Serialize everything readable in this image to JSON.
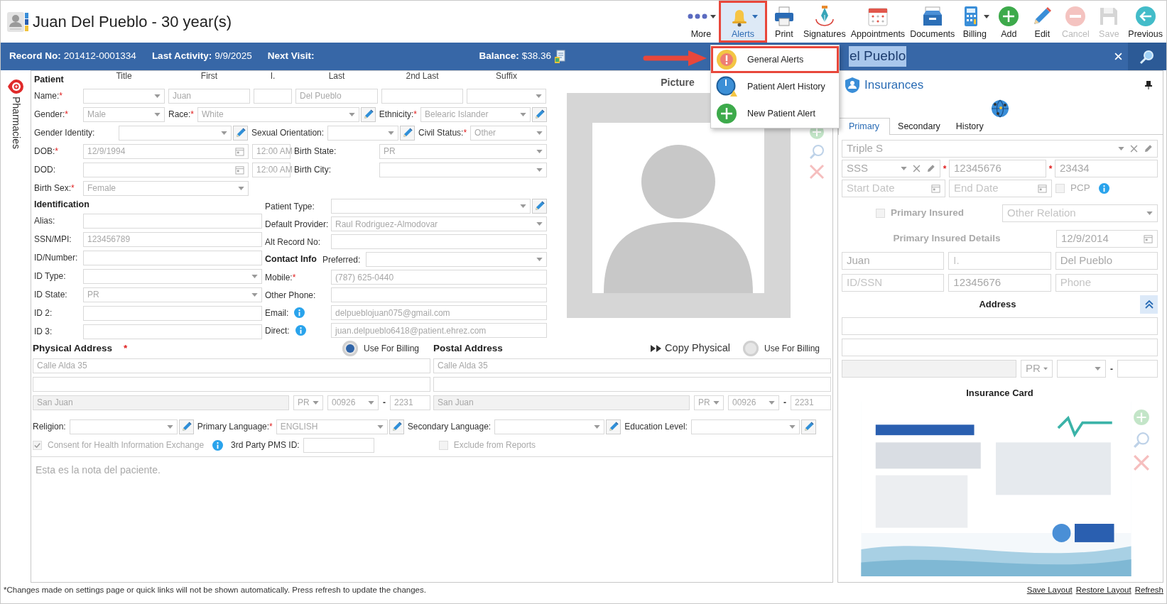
{
  "header": {
    "title": "Juan Del Pueblo - 30 year(s)"
  },
  "toolbar": [
    {
      "label": "More",
      "dropdown": true,
      "disabled": false,
      "selected": false
    },
    {
      "label": "Alerts",
      "dropdown": true,
      "disabled": false,
      "selected": true
    },
    {
      "label": "Print",
      "dropdown": false,
      "disabled": false,
      "selected": false
    },
    {
      "label": "Signatures",
      "dropdown": false,
      "disabled": false,
      "selected": false
    },
    {
      "label": "Appointments",
      "dropdown": false,
      "disabled": false,
      "selected": false
    },
    {
      "label": "Documents",
      "dropdown": false,
      "disabled": false,
      "selected": false
    },
    {
      "label": "Billing",
      "dropdown": true,
      "disabled": false,
      "selected": false
    },
    {
      "label": "Add",
      "dropdown": false,
      "disabled": false,
      "selected": false
    },
    {
      "label": "Edit",
      "dropdown": false,
      "disabled": false,
      "selected": false
    },
    {
      "label": "Cancel",
      "dropdown": false,
      "disabled": true,
      "selected": false
    },
    {
      "label": "Save",
      "dropdown": false,
      "disabled": true,
      "selected": false
    },
    {
      "label": "Previous",
      "dropdown": false,
      "disabled": false,
      "selected": false
    }
  ],
  "info_bar": [
    {
      "label": "Record No:",
      "value": "201412-0001334"
    },
    {
      "label": "Last Activity:",
      "value": "9/9/2025"
    },
    {
      "label": "Next Visit:"
    },
    {
      "label": "Balance:",
      "value": "$38.36"
    }
  ],
  "search": {
    "value": "el Pueblo"
  },
  "alerts_menu": [
    {
      "label": "General Alerts",
      "selected": true
    },
    {
      "label": "Patient Alert History",
      "selected": false
    },
    {
      "label": "New Patient Alert",
      "selected": false
    }
  ],
  "side_tabs": [
    {
      "label": "Pharmacies"
    }
  ],
  "patient": {
    "heading": "Patient",
    "name_columns": [
      "Title",
      "First",
      "I.",
      "Last",
      "2nd Last",
      "Suffix"
    ],
    "rows": [
      {
        "items": [
          {
            "kind": "label",
            "text": "Name:",
            "required_mark": "*"
          },
          {
            "kind": "select"
          },
          {
            "kind": "text",
            "value": "Juan"
          },
          {
            "kind": "text"
          },
          {
            "kind": "text",
            "value": "Del Pueblo"
          },
          {
            "kind": "text"
          },
          {
            "kind": "select"
          }
        ]
      },
      {
        "items": [
          {
            "kind": "label",
            "text": "Gender:",
            "required_mark": "*"
          },
          {
            "kind": "select",
            "value": "Male"
          },
          {
            "kind": "label",
            "text": "Race:",
            "required_mark": "*"
          },
          {
            "kind": "select",
            "value": "White",
            "editable": true
          },
          {
            "kind": "label",
            "text": "Ethnicity:",
            "required_mark": "*"
          },
          {
            "kind": "select",
            "value": "Belearic Islander",
            "editable": true
          }
        ]
      },
      {
        "items": [
          {
            "kind": "label",
            "text": "Gender Identity:"
          },
          {
            "kind": "select",
            "editable": true
          },
          {
            "kind": "label",
            "text": "Sexual Orientation:"
          },
          {
            "kind": "select",
            "editable": true
          },
          {
            "kind": "label",
            "text": "Civil Status:",
            "required_mark": "*"
          },
          {
            "kind": "select",
            "value": "Other"
          }
        ]
      },
      {
        "items": [
          {
            "kind": "label",
            "text": "DOB:",
            "required_mark": "*"
          },
          {
            "kind": "date",
            "value": "12/9/1994"
          },
          {
            "kind": "time",
            "value": "12:00 AM"
          },
          {
            "kind": "label",
            "text": "Birth State:"
          },
          {
            "kind": "select",
            "value": "PR"
          }
        ]
      },
      {
        "items": [
          {
            "kind": "label",
            "text": "DOD:"
          },
          {
            "kind": "date"
          },
          {
            "kind": "time",
            "value": "12:00 AM"
          },
          {
            "kind": "label",
            "text": "Birth City:"
          },
          {
            "kind": "select"
          }
        ]
      },
      {
        "items": [
          {
            "kind": "label",
            "text": "Birth Sex:",
            "required_mark": "*"
          },
          {
            "kind": "select",
            "value": "Female"
          }
        ]
      }
    ]
  },
  "identification": {
    "heading": "Identification",
    "rows": [
      {
        "items": [
          {
            "kind": "label",
            "text": "Alias:"
          },
          {
            "kind": "text"
          }
        ]
      },
      {
        "items": [
          {
            "kind": "label",
            "text": "SSN/MPI:"
          },
          {
            "kind": "text",
            "value": "123456789"
          }
        ]
      },
      {
        "items": [
          {
            "kind": "label",
            "text": "ID/Number:"
          },
          {
            "kind": "text"
          }
        ]
      },
      {
        "items": [
          {
            "kind": "label",
            "text": "ID Type:"
          },
          {
            "kind": "select"
          }
        ]
      },
      {
        "items": [
          {
            "kind": "label",
            "text": "ID State:"
          },
          {
            "kind": "select",
            "value": "PR"
          }
        ]
      },
      {
        "items": [
          {
            "kind": "label",
            "text": "ID 2:"
          },
          {
            "kind": "text"
          }
        ]
      },
      {
        "items": [
          {
            "kind": "label",
            "text": "ID 3:"
          },
          {
            "kind": "text"
          }
        ]
      }
    ]
  },
  "contact": {
    "rows": [
      {
        "items": [
          {
            "kind": "label",
            "text": "Patient Type:"
          },
          {
            "kind": "select",
            "editable": true
          }
        ]
      },
      {
        "items": [
          {
            "kind": "label",
            "text": "Default Provider:"
          },
          {
            "kind": "select",
            "value": "Raul Rodriguez-Almodovar"
          }
        ]
      },
      {
        "items": [
          {
            "kind": "label",
            "text": "Alt Record No:"
          },
          {
            "kind": "text"
          }
        ]
      },
      {
        "items": [
          {
            "kind": "heading",
            "text": "Contact Info"
          },
          {
            "kind": "label",
            "text": "Preferred:"
          },
          {
            "kind": "select"
          }
        ]
      },
      {
        "items": [
          {
            "kind": "label",
            "text": "Mobile:",
            "required_mark": "*"
          },
          {
            "kind": "text",
            "value": "(787) 625-0440"
          }
        ]
      },
      {
        "items": [
          {
            "kind": "label",
            "text": "Other Phone:"
          },
          {
            "kind": "text"
          }
        ]
      },
      {
        "items": [
          {
            "kind": "label",
            "text": "Email:",
            "info": true
          },
          {
            "kind": "text",
            "value": "delpueblojuan075@gmail.com"
          }
        ]
      },
      {
        "items": [
          {
            "kind": "label",
            "text": "Direct:",
            "info": true
          },
          {
            "kind": "text",
            "value": "juan.delpueblo6418@patient.ehrez.com"
          }
        ]
      }
    ]
  },
  "picture": {
    "label": "Picture"
  },
  "addresses": [
    {
      "heading": "Physical Address",
      "required_mark": "*",
      "billing": {
        "label": "Use For Billing",
        "selected": true
      },
      "fields": [
        {
          "kind": "text",
          "value": "Calle Alda 35"
        },
        {
          "kind": "text"
        },
        {
          "kind": "text",
          "value": "San Juan",
          "disabled": true
        },
        {
          "kind": "select",
          "value": "PR"
        },
        {
          "kind": "select",
          "value": "00926"
        },
        {
          "kind": "separator",
          "text": "-"
        },
        {
          "kind": "text",
          "value": "2231"
        }
      ]
    },
    {
      "heading": "Postal Address",
      "copy_label": "Copy Physical",
      "billing": {
        "label": "Use For Billing",
        "selected": false
      },
      "fields": [
        {
          "kind": "text",
          "value": "Calle Alda 35"
        },
        {
          "kind": "text"
        },
        {
          "kind": "text",
          "value": "San Juan",
          "disabled": true
        },
        {
          "kind": "select",
          "value": "PR"
        },
        {
          "kind": "select",
          "value": "00926"
        },
        {
          "kind": "separator",
          "text": "-"
        },
        {
          "kind": "text",
          "value": "2231"
        }
      ]
    }
  ],
  "other_rows": [
    {
      "items": [
        {
          "kind": "label",
          "text": "Religion:"
        },
        {
          "kind": "select",
          "editable": true
        },
        {
          "kind": "label",
          "text": "Primary Language:",
          "required_mark": "*"
        },
        {
          "kind": "select",
          "value": "ENGLISH",
          "editable": true
        },
        {
          "kind": "label",
          "text": "Secondary Language:"
        },
        {
          "kind": "select",
          "editable": true
        },
        {
          "kind": "label",
          "text": "Education Level:"
        },
        {
          "kind": "select",
          "editable": true
        }
      ]
    },
    {
      "items": [
        {
          "kind": "checkbox",
          "label": "Consent for Health Information Exchange",
          "checked": true,
          "disabled": true,
          "info": true
        },
        {
          "kind": "label",
          "text": "3rd Party PMS ID:"
        },
        {
          "kind": "text"
        },
        {
          "kind": "checkbox",
          "label": "Exclude from Reports",
          "checked": false,
          "disabled": true
        }
      ]
    }
  ],
  "note": {
    "value": "Esta es la nota del paciente."
  },
  "insurances": {
    "title": "Insurances",
    "tabs": [
      {
        "label": "Primary",
        "selected": true
      },
      {
        "label": "Secondary",
        "selected": false
      },
      {
        "label": "History",
        "selected": false
      }
    ],
    "rows": [
      {
        "items": [
          {
            "kind": "select",
            "value": "Triple S",
            "clearable": true,
            "editable": true
          }
        ]
      },
      {
        "items": [
          {
            "kind": "select",
            "value": "SSS",
            "clearable": true,
            "editable": true
          },
          {
            "kind": "required_mark",
            "text": "*"
          },
          {
            "kind": "text",
            "value": "12345676"
          },
          {
            "kind": "required_mark",
            "text": "*"
          },
          {
            "kind": "text",
            "value": "23434"
          }
        ]
      },
      {
        "items": [
          {
            "kind": "date",
            "placeholder": "Start Date"
          },
          {
            "kind": "date",
            "placeholder": "End Date"
          },
          {
            "kind": "checkbox",
            "label": "PCP",
            "checked": false,
            "disabled": true,
            "info": true
          }
        ]
      },
      {
        "items": [
          {
            "kind": "checkbox",
            "label": "Primary Insured",
            "checked": false,
            "disabled": true
          },
          {
            "kind": "select",
            "placeholder": "Other Relation"
          }
        ]
      },
      {
        "items": [
          {
            "kind": "heading",
            "text": "Primary Insured Details",
            "disabled": true
          },
          {
            "kind": "date",
            "value": "12/9/2014"
          }
        ]
      },
      {
        "items": [
          {
            "kind": "text",
            "value": "Juan"
          },
          {
            "kind": "text",
            "placeholder": "I."
          },
          {
            "kind": "text",
            "value": "Del Pueblo"
          }
        ]
      },
      {
        "items": [
          {
            "kind": "text",
            "placeholder": "ID/SSN"
          },
          {
            "kind": "text",
            "value": "12345676"
          },
          {
            "kind": "text",
            "placeholder": "Phone"
          }
        ]
      },
      {
        "items": [
          {
            "kind": "heading",
            "text": "Address"
          },
          {
            "kind": "collapse",
            "expanded": true
          }
        ]
      },
      {
        "items": [
          {
            "kind": "text"
          }
        ]
      },
      {
        "items": [
          {
            "kind": "text"
          }
        ]
      },
      {
        "items": [
          {
            "kind": "text",
            "disabled": true
          },
          {
            "kind": "select",
            "value": "PR"
          },
          {
            "kind": "select"
          },
          {
            "kind": "separator",
            "text": "-"
          },
          {
            "kind": "text"
          }
        ]
      },
      {
        "items": [
          {
            "kind": "heading",
            "text": "Insurance Card"
          }
        ]
      },
      {
        "items": [
          {
            "kind": "picture"
          }
        ]
      }
    ]
  },
  "footer": {
    "note": "*Changes made on settings page or quick links will not be shown automatically. Press refresh to update the changes.",
    "links": [
      "Save Layout",
      "Restore Layout",
      "Refresh"
    ]
  }
}
